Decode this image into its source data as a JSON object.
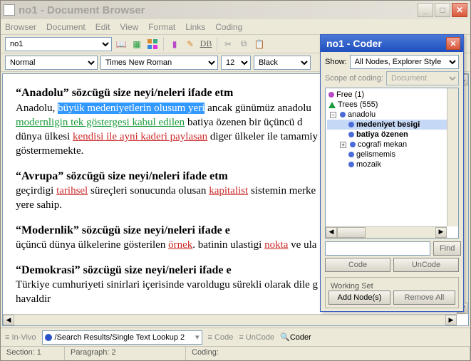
{
  "window": {
    "title": "no1 - Document Browser"
  },
  "menu": {
    "items": [
      "Browser",
      "Document",
      "Edit",
      "View",
      "Format",
      "Links",
      "Coding"
    ]
  },
  "toolbar": {
    "doc_selector": "no1",
    "icons": [
      "book-icon",
      "grid-icon",
      "colorgrid-icon",
      "doc-icon",
      "brush-icon",
      "db-icon"
    ],
    "db_label": "DB",
    "edit_icons": [
      "cut-icon",
      "copy-icon",
      "paste-icon"
    ]
  },
  "format_bar": {
    "style": "Normal",
    "font": "Times New Roman",
    "size": "12",
    "color": "Black"
  },
  "document": {
    "h1": "“Anadolu” sözcügü size neyi/neleri ifade etm",
    "p1a": "Anadolu, ",
    "p1_highlight": "büyük medeniyetlerin olusum yeri",
    "p1b": " ancak günümüz anadolu",
    "p1_link1": "modernligin tek göstergesi kabul edilen",
    "p1c": " batiya özenen bir üçüncü d",
    "p1d": "dünya ülkesi ",
    "p1_link2": "kendisi ile ayni kaderi paylasan",
    "p1e": " diger ülkeler ile tamamiy",
    "p1f": "göstermemekte.",
    "h2": "“Avrupa” sözcügü size neyi/neleri ifade etm",
    "p2a": "geçirdigi ",
    "p2_link1": "tarihsel",
    "p2b": " süreçleri sonucunda olusan ",
    "p2_link2": "kapitalist",
    "p2c": " sistemin merke",
    "p2d": "yere sahip.",
    "h3": "“Modernlik” sözcügü size neyi/neleri ifade e",
    "p3a": "üçüncü dünya ülkelerine gösterilen ",
    "p3_link1": "örnek",
    "p3b": ". batinin ulastigi ",
    "p3_link2": "nokta",
    "p3c": " ve ula",
    "h4": "“Demokrasi” sözcügü size neyi/neleri ifade e",
    "p4a": "Türkiye cumhuriyeti sinirlari içerisinde varoldugu sürekli olarak dile g",
    "p4b": "havaldir"
  },
  "coder": {
    "title": "no1 - Coder",
    "show_label": "Show:",
    "show_value": "All Nodes, Explorer Style",
    "scope_label": "Scope of coding:",
    "scope_value": "Document",
    "tree": {
      "free": "Free (1)",
      "trees": "Trees (555)",
      "root": "anadolu",
      "children": [
        {
          "label": "medeniyet besigi",
          "selected": true
        },
        {
          "label": "batiya özenen"
        },
        {
          "label": "cografi mekan",
          "expandable": true
        },
        {
          "label": "gelismemis"
        },
        {
          "label": "mozaik"
        }
      ]
    },
    "find_label": "Find",
    "code_label": "Code",
    "uncode_label": "UnCode",
    "working_set_label": "Working Set",
    "add_nodes_label": "Add Node(s)",
    "remove_all_label": "Remove All"
  },
  "bottom": {
    "invivo": "In-Vivo",
    "search_combo": "/Search Results/Single Text Lookup 2",
    "code": "Code",
    "uncode": "UnCode",
    "coder": "Coder"
  },
  "status": {
    "section": "Section:  1",
    "paragraph": "Paragraph:  2",
    "coding": "Coding:"
  }
}
